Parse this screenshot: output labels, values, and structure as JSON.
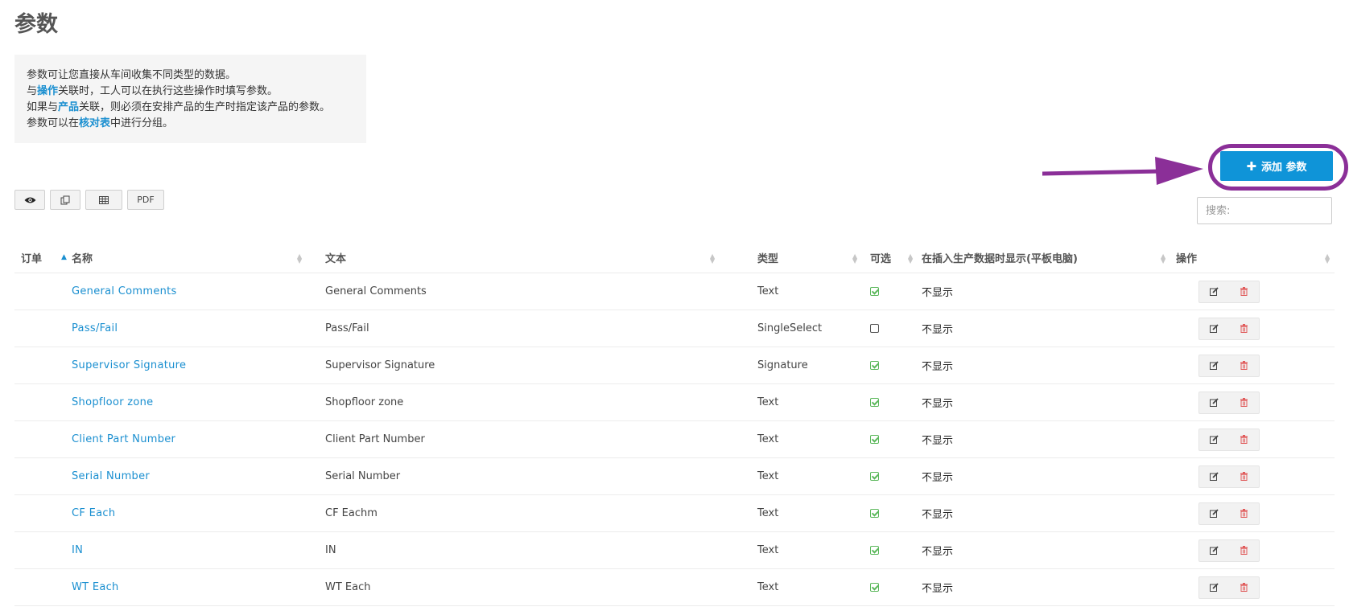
{
  "page": {
    "title": "参数"
  },
  "info": {
    "line1": "参数可让您直接从车间收集不同类型的数据。",
    "line2_prefix": "与",
    "line2_link": "操作",
    "line2_suffix": "关联时，工人可以在执行这些操作时填写参数。",
    "line3_prefix": "如果与",
    "line3_link": "产品",
    "line3_suffix": "关联，则必须在安排产品的生产时指定该产品的参数。",
    "line4_prefix": "参数可以在",
    "line4_link": "核对表",
    "line4_suffix": "中进行分组。"
  },
  "actions": {
    "add_label": "添加 参数",
    "add_icon": "plus-icon"
  },
  "toolbar": {
    "pdf_label": "PDF",
    "buttons": [
      "eye-icon",
      "copy-icon",
      "grid-icon",
      "pdf"
    ]
  },
  "search": {
    "placeholder": "搜索:",
    "value": ""
  },
  "table": {
    "headers": {
      "order": "订单",
      "name": "名称",
      "text": "文本",
      "type": "类型",
      "optional": "可选",
      "display": "在插入生产数据时显示(平板电脑)",
      "actions": "操作"
    },
    "rows": [
      {
        "name": "General Comments",
        "text": "General Comments",
        "type": "Text",
        "optional": true,
        "display": "不显示"
      },
      {
        "name": "Pass/Fail",
        "text": "Pass/Fail",
        "type": "SingleSelect",
        "optional": false,
        "display": "不显示"
      },
      {
        "name": "Supervisor Signature",
        "text": "Supervisor Signature",
        "type": "Signature",
        "optional": true,
        "display": "不显示"
      },
      {
        "name": "Shopfloor zone",
        "text": "Shopfloor zone",
        "type": "Text",
        "optional": true,
        "display": "不显示"
      },
      {
        "name": "Client Part Number",
        "text": "Client Part Number",
        "type": "Text",
        "optional": true,
        "display": "不显示"
      },
      {
        "name": "Serial Number",
        "text": "Serial Number",
        "type": "Text",
        "optional": true,
        "display": "不显示"
      },
      {
        "name": "CF Each",
        "text": "CF Eachm",
        "type": "Text",
        "optional": true,
        "display": "不显示"
      },
      {
        "name": "IN",
        "text": "IN",
        "type": "Text",
        "optional": true,
        "display": "不显示"
      },
      {
        "name": "WT Each",
        "text": "WT Each",
        "type": "Text",
        "optional": true,
        "display": "不显示"
      }
    ]
  },
  "colors": {
    "accent": "#0f94d8",
    "link": "#1a8fd0",
    "highlight": "#8b2f98",
    "check": "#5cb85c",
    "delete": "#e05a5a"
  }
}
